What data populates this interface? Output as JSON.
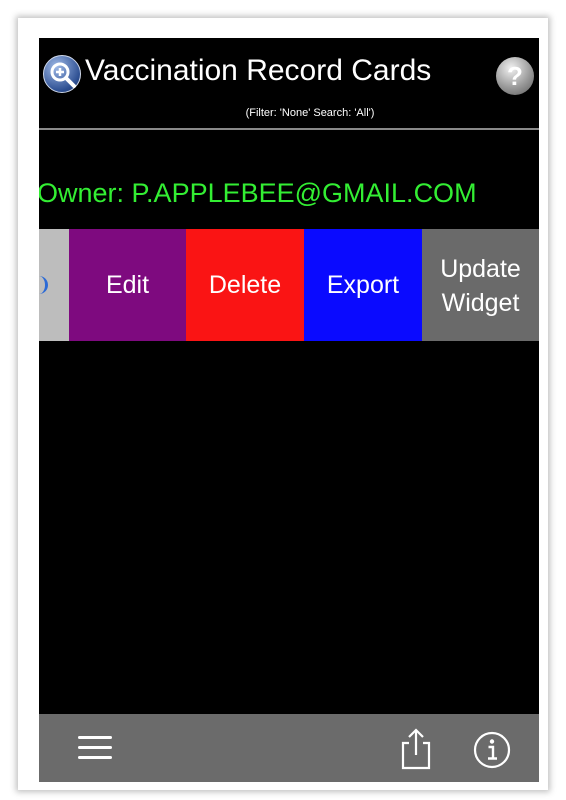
{
  "header": {
    "title": "Vaccination Record Cards",
    "subtitle": "(Filter: 'None' Search: 'All')",
    "help_label": "?",
    "icons": {
      "search": "search-zoom-icon",
      "help": "help-icon"
    }
  },
  "owner": {
    "text": "Owner: P.APPLEBEE@GMAIL.COM",
    "color": "#33ee33"
  },
  "actions": {
    "edit": "Edit",
    "delete": "Delete",
    "export": "Export",
    "update_widget_line1": "Update",
    "update_widget_line2": "Widget",
    "colors": {
      "edit": "#7e0a7f",
      "delete": "#fa1414",
      "export": "#0a0aff",
      "update_widget": "#6a6a6a"
    }
  },
  "footer": {
    "icons": {
      "menu": "hamburger-menu-icon",
      "share": "share-icon",
      "info": "info-icon"
    }
  }
}
